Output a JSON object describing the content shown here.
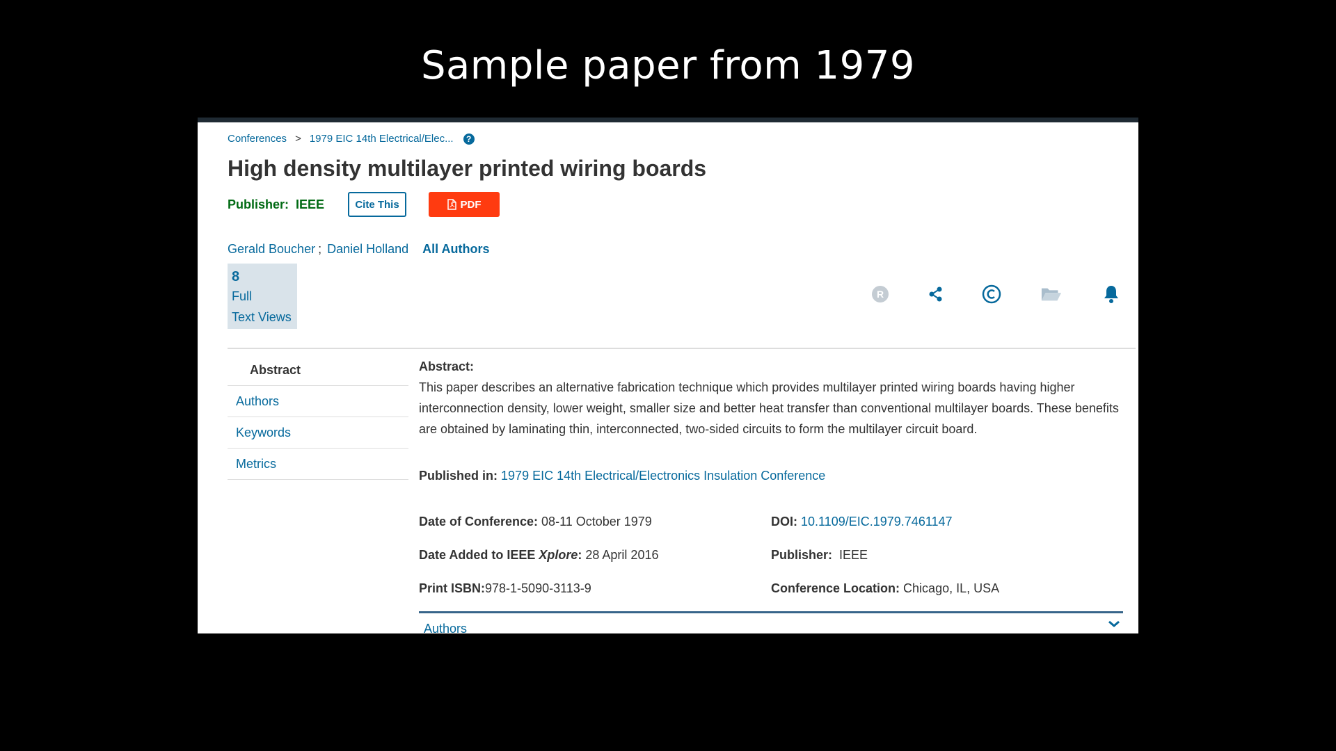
{
  "slide_title": "Sample paper from 1979",
  "breadcrumb": {
    "items": [
      "Conferences",
      "1979 EIC 14th Electrical/Elec..."
    ],
    "separator": ">",
    "help_icon": "question-circle-icon"
  },
  "paper": {
    "title": "High density multilayer printed wiring boards",
    "publisher_label": "Publisher:",
    "publisher_value": "IEEE",
    "cite_label": "Cite This",
    "pdf_label": "PDF"
  },
  "authors": {
    "list": [
      "Gerald Boucher",
      "Daniel Holland"
    ],
    "separator": ";",
    "all_label": "All Authors"
  },
  "metrics": {
    "count": "8",
    "line1": "Full",
    "line2": "Text Views"
  },
  "toolbar_icons": [
    "rights-icon",
    "share-icon",
    "copyright-icon",
    "folder-icon",
    "bell-icon"
  ],
  "sidenav": {
    "items": [
      "Abstract",
      "Authors",
      "Keywords",
      "Metrics"
    ],
    "active": "Abstract"
  },
  "abstract": {
    "label": "Abstract:",
    "text": "This paper describes an alternative fabrication technique which provides multilayer printed wiring boards having higher interconnection density, lower weight, smaller size and better heat transfer than conventional multilayer boards. These benefits are obtained by laminating thin, interconnected, two-sided circuits to form the multilayer circuit board."
  },
  "published_in": {
    "label": "Published in:",
    "value": "1979 EIC 14th Electrical/Electronics Insulation Conference"
  },
  "details": {
    "date_of_conference": {
      "label": "Date of Conference:",
      "value": "08-11 October 1979"
    },
    "date_added": {
      "label_pre": "Date Added to IEEE ",
      "label_em": "Xplore",
      "label_post": ":",
      "value": "28 April 2016"
    },
    "isbn": {
      "label": "Print ISBN:",
      "value": "978-1-5090-3113-9"
    },
    "doi": {
      "label": "DOI:",
      "value": "10.1109/EIC.1979.7461147"
    },
    "publisher": {
      "label": "Publisher:",
      "value": "IEEE"
    },
    "location": {
      "label": "Conference Location:",
      "value": "Chicago, IL, USA"
    }
  },
  "accordion": {
    "label": "Authors",
    "icon": "chevron-down-icon"
  },
  "colors": {
    "link": "#06699c",
    "pdf": "#ff3b10",
    "publisher": "#006a13",
    "metric_bg": "#d9e3ea"
  }
}
